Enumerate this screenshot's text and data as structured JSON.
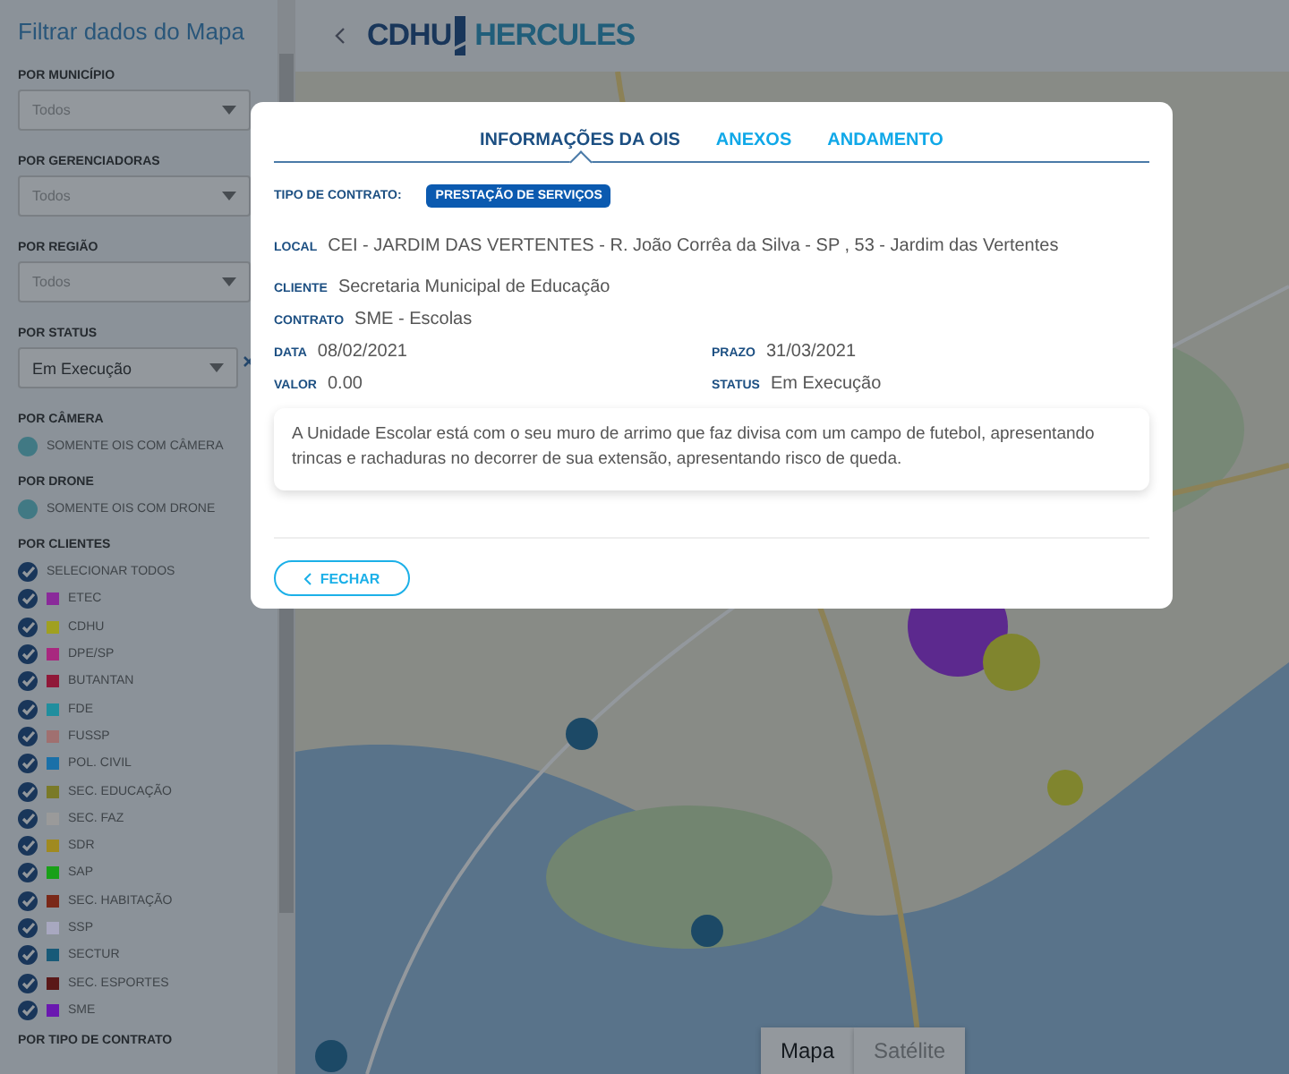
{
  "sidebar": {
    "title": "Filtrar dados do Mapa",
    "sections": [
      {
        "kind": "select",
        "label": "POR MUNICÍPIO",
        "placeholder": "Todos",
        "clearable": false
      },
      {
        "kind": "select",
        "label": "POR GERENCIADORAS",
        "placeholder": "Todos",
        "clearable": false
      },
      {
        "kind": "select",
        "label": "POR REGIÃO",
        "placeholder": "Todos",
        "clearable": false
      },
      {
        "kind": "select",
        "label": "POR STATUS",
        "value": "Em Execução",
        "clearable": true
      },
      {
        "kind": "checkboxes",
        "label": "POR CÂMERA",
        "options": [
          {
            "label": "SOMENTE OIS COM CÂMERA",
            "checked": false
          }
        ]
      },
      {
        "kind": "checkboxes",
        "label": "POR DRONE",
        "options": [
          {
            "label": "SOMENTE OIS COM DRONE",
            "checked": false
          }
        ]
      },
      {
        "kind": "checkboxes",
        "label": "POR CLIENTES",
        "options": [
          {
            "label": "SELECIONAR TODOS",
            "checked": true
          },
          {
            "label": "ETEC",
            "checked": true,
            "color": "#8a2a9a"
          },
          {
            "label": "CDHU",
            "checked": true,
            "color": "#a0a020"
          },
          {
            "label": "DPE/SP",
            "checked": true,
            "color": "#a8287f"
          },
          {
            "label": "BUTANTAN",
            "checked": true,
            "color": "#901838"
          },
          {
            "label": "FDE",
            "checked": true,
            "color": "#208e9e"
          },
          {
            "label": "FUSSP",
            "checked": true,
            "color": "#a07070"
          },
          {
            "label": "POL. CIVIL",
            "checked": true,
            "color": "#1a70a8"
          },
          {
            "label": "SEC. EDUCAÇÃO",
            "checked": true,
            "color": "#7a7a28"
          },
          {
            "label": "SEC. FAZ",
            "checked": true,
            "color": "#9a9a9a"
          },
          {
            "label": "SDR",
            "checked": true,
            "color": "#a08a20"
          },
          {
            "label": "SAP",
            "checked": true,
            "color": "#18a018"
          },
          {
            "label": "SEC. HABITAÇÃO",
            "checked": true,
            "color": "#7a2818"
          },
          {
            "label": "SSP",
            "checked": true,
            "color": "#a8a8c0"
          },
          {
            "label": "SECTUR",
            "checked": true,
            "color": "#185a78"
          },
          {
            "label": "SEC. ESPORTES",
            "checked": true,
            "color": "#5a1818"
          },
          {
            "label": "SME",
            "checked": true,
            "color": "#6a18b0"
          }
        ]
      },
      {
        "kind": "heading",
        "label": "POR TIPO DE CONTRATO"
      }
    ]
  },
  "header": {
    "logo_left": "CDHU",
    "logo_right": "HERCULES"
  },
  "map": {
    "kind": "picture",
    "map_types": [
      {
        "label": "Mapa",
        "selected": true
      },
      {
        "label": "Satélite",
        "selected": false
      }
    ]
  },
  "modal": {
    "tabs": [
      {
        "label": "INFORMAÇÕES DA OIS",
        "selected": true
      },
      {
        "label": "ANEXOS",
        "selected": false
      },
      {
        "label": "ANDAMENTO",
        "selected": false
      }
    ],
    "contract_type_label": "TIPO DE CONTRATO:",
    "contract_type": "PRESTAÇÃO DE SERVIÇOS",
    "rows": [
      [
        {
          "label": "LOCAL",
          "value": "CEI - JARDIM DAS VERTENTES - R. João Corrêa da Silva - SP , 53 - Jardim das Vertentes"
        }
      ],
      [
        {
          "label": "CLIENTE",
          "value": "Secretaria Municipal de Educação"
        }
      ],
      [
        {
          "label": "CONTRATO",
          "value": "SME - Escolas"
        }
      ],
      [
        {
          "label": "DATA",
          "value": "08/02/2021"
        },
        {
          "label": "PRAZO",
          "value": "31/03/2021"
        }
      ],
      [
        {
          "label": "VALOR",
          "value": "0.00"
        },
        {
          "label": "STATUS",
          "value": "Em Execução"
        }
      ]
    ],
    "description": "A Unidade Escolar está com o seu muro de arrimo que faz divisa com um campo de futebol, apresentando trincas e rachaduras no decorrer de sua extensão, apresentando risco de queda.",
    "close_button": "FECHAR"
  }
}
